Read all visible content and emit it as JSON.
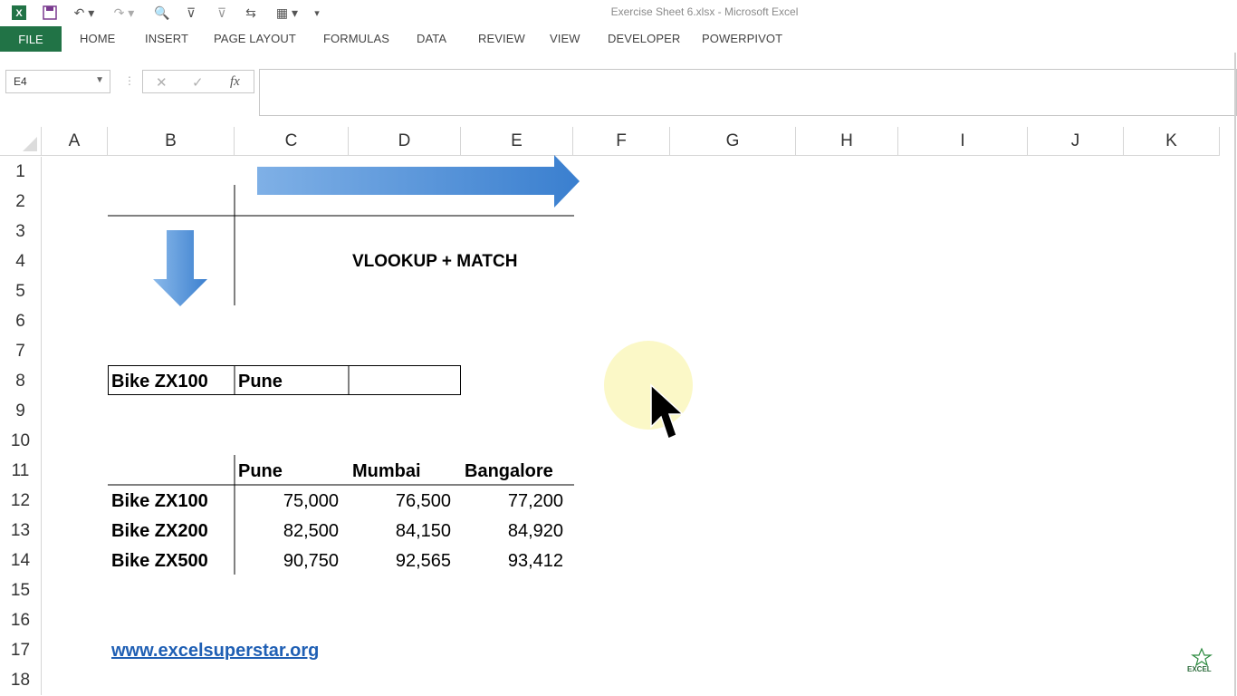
{
  "window": {
    "title": "Exercise Sheet 6.xlsx - Microsoft Excel"
  },
  "ribbon": {
    "file": "FILE",
    "tabs": [
      "HOME",
      "INSERT",
      "PAGE LAYOUT",
      "FORMULAS",
      "DATA",
      "REVIEW",
      "VIEW",
      "DEVELOPER",
      "POWERPIVOT"
    ]
  },
  "formula_bar": {
    "name_box": "E4",
    "fx_label": "fx",
    "formula": ""
  },
  "columns": [
    "A",
    "B",
    "C",
    "D",
    "E",
    "F",
    "G",
    "H",
    "I",
    "J",
    "K"
  ],
  "rows": [
    "1",
    "2",
    "3",
    "4",
    "5",
    "6",
    "7",
    "8",
    "9",
    "10",
    "11",
    "12",
    "13",
    "14",
    "15",
    "16",
    "17",
    "18"
  ],
  "sheet": {
    "heading": "VLOOKUP + MATCH",
    "lookup": {
      "product": "Bike ZX100",
      "city": "Pune",
      "result": ""
    },
    "table": {
      "headers": [
        "Pune",
        "Mumbai",
        "Bangalore"
      ],
      "rows": [
        {
          "label": "Bike ZX100",
          "values": [
            "75,000",
            "76,500",
            "77,200"
          ]
        },
        {
          "label": "Bike ZX200",
          "values": [
            "82,500",
            "84,150",
            "84,920"
          ]
        },
        {
          "label": "Bike ZX500",
          "values": [
            "90,750",
            "92,565",
            "93,412"
          ]
        }
      ]
    },
    "link": "www.excelsuperstar.org",
    "watermark": "EXCEL"
  },
  "colors": {
    "file_tab": "#217346",
    "arrow_blue": "#3f86d2",
    "link_blue": "#1f5fb4",
    "cursor_highlight": "#fbf8c4"
  }
}
